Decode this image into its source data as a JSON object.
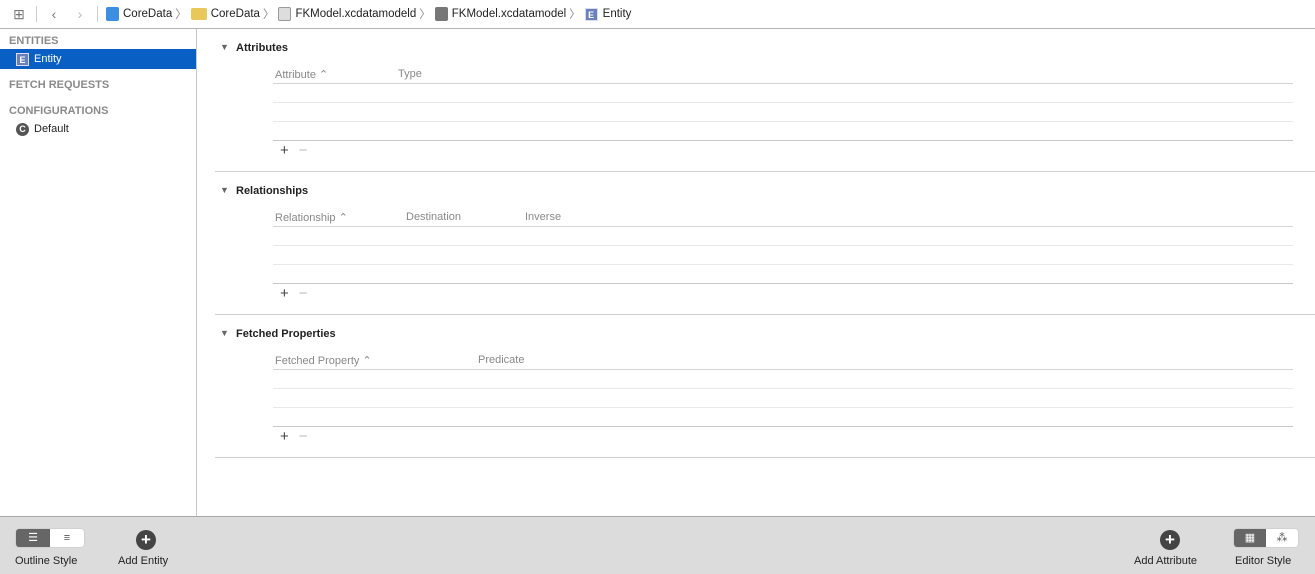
{
  "breadcrumb": [
    "CoreData",
    "CoreData",
    "FKModel.xcdatamodeld",
    "FKModel.xcdatamodel",
    "Entity"
  ],
  "sidebar": {
    "entities_header": "ENTITIES",
    "entities": [
      {
        "label": "Entity",
        "icon": "E"
      }
    ],
    "fetch_header": "FETCH REQUESTS",
    "config_header": "CONFIGURATIONS",
    "configs": [
      {
        "label": "Default",
        "icon": "C"
      }
    ]
  },
  "sections": [
    {
      "title": "Attributes",
      "columns": [
        "Attribute ⌃",
        "Type"
      ]
    },
    {
      "title": "Relationships",
      "columns": [
        "Relationship ⌃",
        "Destination",
        "Inverse"
      ]
    },
    {
      "title": "Fetched Properties",
      "columns": [
        "Fetched Property ⌃",
        "Predicate"
      ]
    }
  ],
  "bottom": {
    "outline_style": "Outline Style",
    "add_entity": "Add Entity",
    "add_attribute": "Add Attribute",
    "editor_style": "Editor Style"
  },
  "colors": {
    "selection": "#0a5fc4",
    "bottom_bar": "#dcdcdc"
  }
}
